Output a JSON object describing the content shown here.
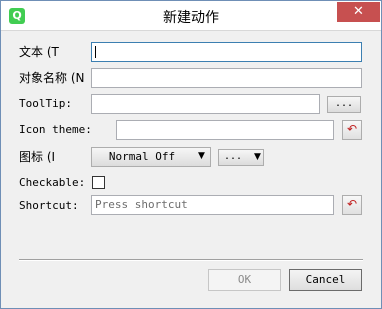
{
  "window": {
    "title": "新建动作",
    "app_icon": "Q",
    "close_glyph": "✕"
  },
  "form": {
    "text_label": "文本 (T",
    "text_value": "",
    "object_name_label": "对象名称 (N",
    "object_name_value": "",
    "tooltip_label": "ToolTip:",
    "tooltip_value": "",
    "tooltip_button": "...",
    "icon_theme_label": "Icon theme:",
    "icon_theme_value": "",
    "icon_theme_reset_glyph": "↶",
    "icon_label": "图标 (I",
    "icon_mode": "Normal Off",
    "icon_mode_arrow": "▼",
    "icon_browse": "...",
    "icon_browse_arrow": "▼",
    "checkable_label": "Checkable:",
    "checkable_checked": false,
    "shortcut_label": "Shortcut:",
    "shortcut_placeholder": "Press shortcut",
    "shortcut_reset_glyph": "↶"
  },
  "buttons": {
    "ok": "OK",
    "cancel": "Cancel"
  }
}
